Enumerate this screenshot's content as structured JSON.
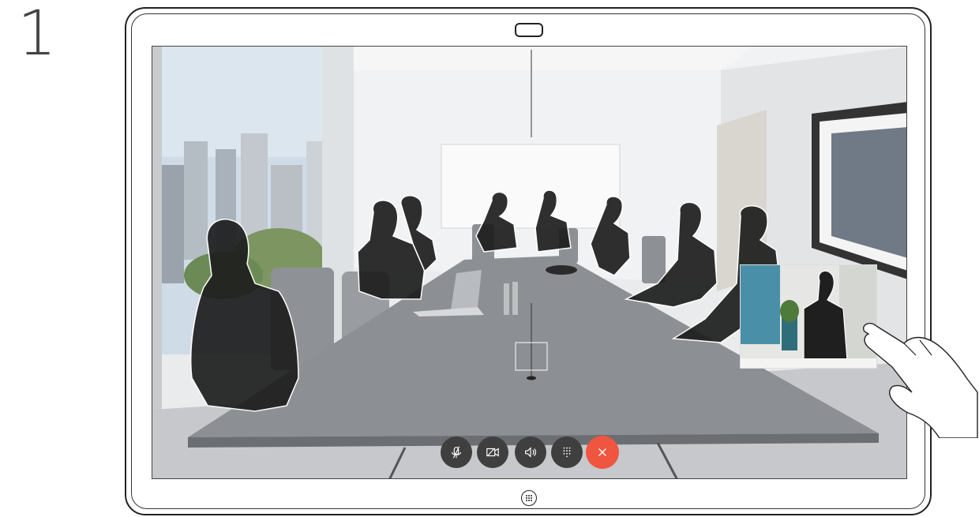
{
  "step": {
    "number": "1"
  },
  "device": {
    "name": "touch-display-room-device"
  },
  "call": {
    "view": "video-call",
    "self_view": "self-view-pip",
    "controls": [
      {
        "name": "mute-button",
        "icon": "microphone-muted-icon"
      },
      {
        "name": "camera-button",
        "icon": "camera-off-icon"
      },
      {
        "name": "volume-button",
        "icon": "speaker-icon"
      },
      {
        "name": "keypad-button",
        "icon": "keypad-icon"
      },
      {
        "name": "end-call-button",
        "icon": "close-icon"
      }
    ]
  },
  "colors": {
    "end_call": "#f0553f",
    "control_bg": "#3f3f3f",
    "frame": "#222222"
  }
}
